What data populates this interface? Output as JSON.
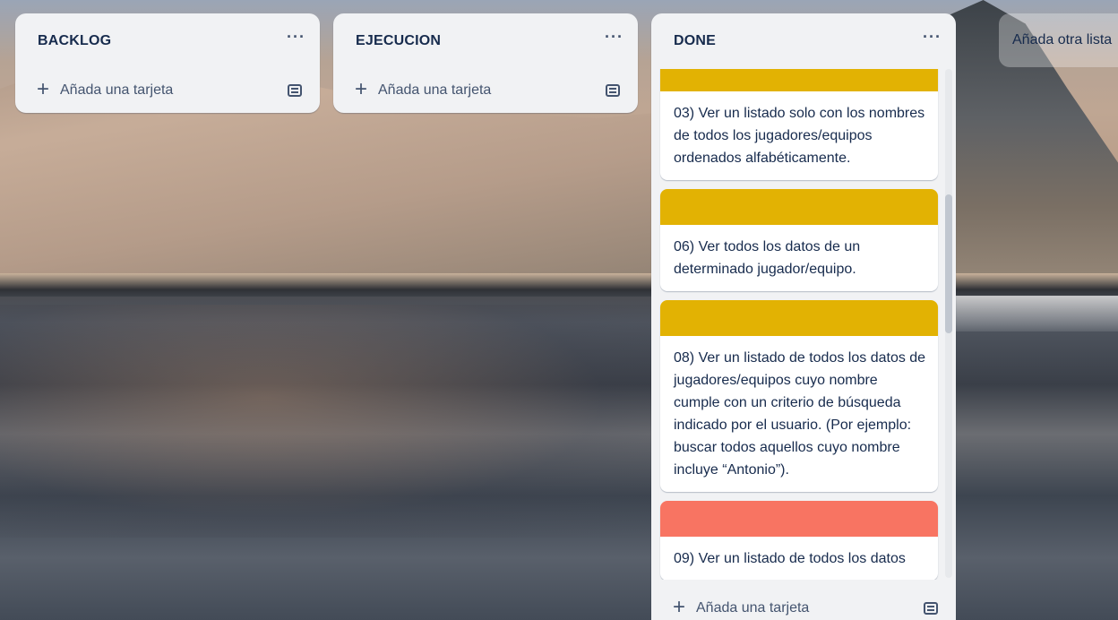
{
  "lists": [
    {
      "title": "BACKLOG",
      "menu": "···",
      "add_card_label": "Añada una tarjeta"
    },
    {
      "title": "EJECUCION",
      "menu": "···",
      "add_card_label": "Añada una tarjeta"
    },
    {
      "title": "DONE",
      "menu": "···",
      "add_card_label": "Añada una tarjeta",
      "cards": [
        {
          "cover_color": "#e2b203",
          "text": "03) Ver un listado solo con los nombres de todos los jugadores/equipos ordenados alfabéticamente."
        },
        {
          "cover_color": "#e2b203",
          "text": "06) Ver todos los datos de un determinado jugador/equipo."
        },
        {
          "cover_color": "#e2b203",
          "text": "08) Ver un listado de todos los datos de jugadores/equipos cuyo nombre cumple con un criterio de búsqueda indicado por el usuario. (Por ejemplo: buscar todos aquellos cuyo nombre incluye “Antonio”)."
        },
        {
          "cover_color": "#f87462",
          "text": "09) Ver un listado de todos los datos"
        }
      ]
    }
  ],
  "add_list_label": "Añada otra lista",
  "colors": {
    "list_bg": "#f1f2f4",
    "text_primary": "#172b4d",
    "text_secondary": "#44546f"
  }
}
